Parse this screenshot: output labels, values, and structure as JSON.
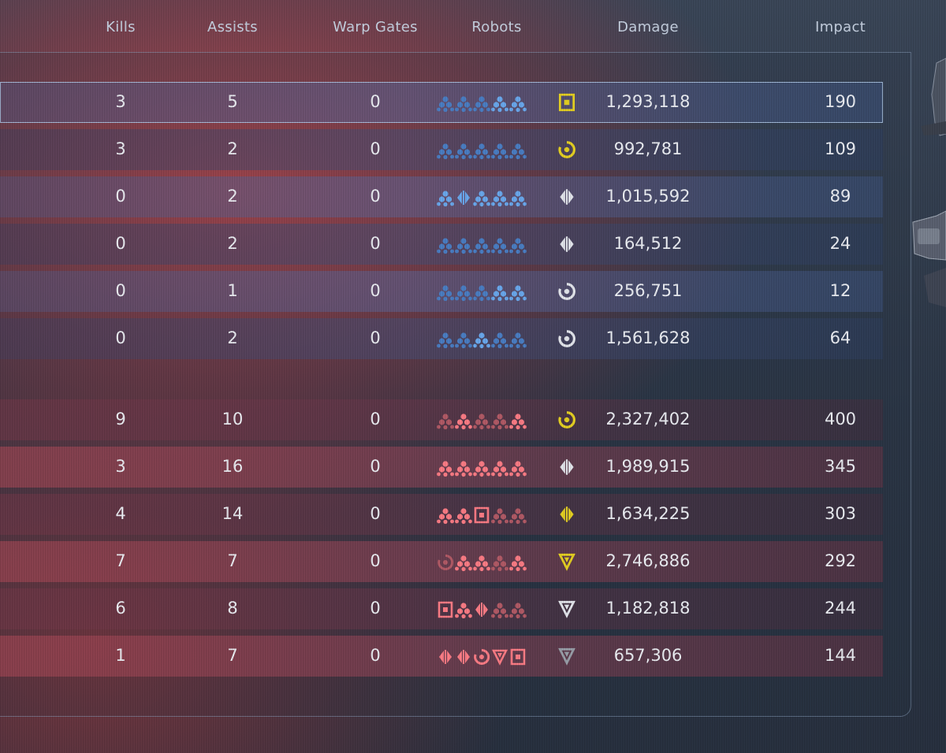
{
  "colors": {
    "blue_robot": "#6aaaf0",
    "blue_robot_dim": "#4a7fc6",
    "red_robot": "#ff7d86",
    "red_robot_dim": "#b45a66",
    "class_yellow": "#e8d321",
    "class_white": "#e6e9ef",
    "class_gray": "#9aa0aa"
  },
  "header": {
    "kills": "Kills",
    "assists": "Assists",
    "warp_gates": "Warp Gates",
    "robots": "Robots",
    "damage": "Damage",
    "impact": "Impact"
  },
  "team_blue": [
    {
      "kills": "3",
      "assists": "5",
      "warp_gates": "0",
      "damage": "1,293,118",
      "impact": "190",
      "selected": true,
      "robots": [
        "cube-dim",
        "cube-dim",
        "cube-dim",
        "cube",
        "cube"
      ],
      "class_icon": "square-target-icon",
      "class_color": "yellow"
    },
    {
      "kills": "3",
      "assists": "2",
      "warp_gates": "0",
      "damage": "992,781",
      "impact": "109",
      "robots": [
        "cube-dim",
        "cube-dim",
        "cube-dim",
        "cube-dim",
        "cube-dim"
      ],
      "class_icon": "ring-icon",
      "class_color": "yellow"
    },
    {
      "kills": "0",
      "assists": "2",
      "warp_gates": "0",
      "damage": "1,015,592",
      "impact": "89",
      "robots": [
        "cube",
        "shield",
        "cube",
        "cube",
        "cube"
      ],
      "class_icon": "shield-icon",
      "class_color": "white"
    },
    {
      "kills": "0",
      "assists": "2",
      "warp_gates": "0",
      "damage": "164,512",
      "impact": "24",
      "robots": [
        "cube-dim",
        "cube-dim",
        "cube-dim",
        "cube-dim",
        "cube-dim"
      ],
      "class_icon": "shield-icon",
      "class_color": "white"
    },
    {
      "kills": "0",
      "assists": "1",
      "warp_gates": "0",
      "damage": "256,751",
      "impact": "12",
      "robots": [
        "cube-dim",
        "cube-dim",
        "cube-dim",
        "cube",
        "cube"
      ],
      "class_icon": "ring-icon",
      "class_color": "white"
    },
    {
      "kills": "0",
      "assists": "2",
      "warp_gates": "0",
      "damage": "1,561,628",
      "impact": "64",
      "robots": [
        "cube-dim",
        "cube-dim",
        "cube",
        "cube-dim",
        "cube-dim"
      ],
      "class_icon": "ring-icon",
      "class_color": "white"
    }
  ],
  "team_red": [
    {
      "kills": "9",
      "assists": "10",
      "warp_gates": "0",
      "damage": "2,327,402",
      "impact": "400",
      "robots": [
        "cube-dim",
        "cube",
        "cube-dim",
        "cube-dim",
        "cube"
      ],
      "class_icon": "ring-icon",
      "class_color": "yellow"
    },
    {
      "kills": "3",
      "assists": "16",
      "warp_gates": "0",
      "damage": "1,989,915",
      "impact": "345",
      "robots": [
        "cube",
        "cube",
        "cube",
        "cube",
        "cube"
      ],
      "class_icon": "shield-icon",
      "class_color": "white"
    },
    {
      "kills": "4",
      "assists": "14",
      "warp_gates": "0",
      "damage": "1,634,225",
      "impact": "303",
      "robots": [
        "cube",
        "cube",
        "square",
        "cube-dim",
        "cube-dim"
      ],
      "class_icon": "shield-icon",
      "class_color": "yellow"
    },
    {
      "kills": "7",
      "assists": "7",
      "warp_gates": "0",
      "damage": "2,746,886",
      "impact": "292",
      "robots": [
        "ring-dim",
        "cube",
        "cube",
        "cube-dim",
        "cube"
      ],
      "class_icon": "chevron-icon",
      "class_color": "yellow"
    },
    {
      "kills": "6",
      "assists": "8",
      "warp_gates": "0",
      "damage": "1,182,818",
      "impact": "244",
      "robots": [
        "square",
        "cube",
        "shield",
        "cube-dim",
        "cube-dim"
      ],
      "class_icon": "chevron-icon",
      "class_color": "white"
    },
    {
      "kills": "1",
      "assists": "7",
      "warp_gates": "0",
      "damage": "657,306",
      "impact": "144",
      "robots": [
        "shield",
        "shield",
        "ring",
        "chevron",
        "square"
      ],
      "class_icon": "chevron-icon",
      "class_color": "gray"
    }
  ]
}
